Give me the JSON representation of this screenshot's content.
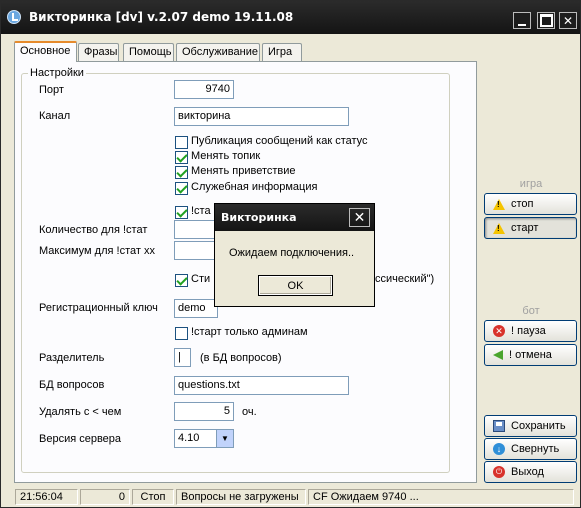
{
  "window": {
    "title": "Викторинка [dv] v.2.07 demo 19.11.08"
  },
  "tabs": [
    {
      "label": "Основное",
      "active": true
    },
    {
      "label": "Фразы"
    },
    {
      "label": "Помощь"
    },
    {
      "label": "Обслуживание"
    },
    {
      "label": "Игра"
    }
  ],
  "settings": {
    "group_title": "Настройки",
    "port_label": "Порт",
    "port_value": "9740",
    "channel_label": "Канал",
    "channel_value": "викторина",
    "checks": {
      "publish_status": {
        "label": "Публикация сообщений как статус",
        "checked": false
      },
      "change_topic": {
        "label": "Менять топик",
        "checked": true
      },
      "change_greeting": {
        "label": "Менять приветствие",
        "checked": true
      },
      "service_info": {
        "label": "Служебная информация",
        "checked": true
      },
      "stat_partial": {
        "label": "!ста",
        "checked": true
      },
      "style_partial": {
        "label": "Сти",
        "checked": true
      },
      "start_admins": {
        "label": "!старт только админам",
        "checked": false
      }
    },
    "style_suffix": "ссический\")",
    "count_stat_label": "Количество для !стат",
    "max_stat_label": "Максимум для  !стат xx",
    "reg_key_label": "Регистрационный ключ",
    "reg_key_value": "demo",
    "separator_label": "Разделитель",
    "separator_value": "|",
    "separator_hint": "(в БД вопросов)",
    "db_label": "БД вопросов",
    "db_value": "questions.txt",
    "remove_label": "Удалять  с < чем",
    "remove_value": "5",
    "remove_unit": "оч.",
    "server_version_label": "Версия сервера",
    "server_version_value": "4.10"
  },
  "side": {
    "game_caption": "игра",
    "stop_label": "стоп",
    "start_label": "старт",
    "bot_caption": "бот",
    "pause_label": "! пауза",
    "cancel_label": "! отмена",
    "save_label": "Сохранить",
    "minimize_label": "Свернуть",
    "exit_label": "Выход"
  },
  "status": {
    "time": "21:56:04",
    "count": "0",
    "state": "Стоп",
    "questions": "Вопросы не загружены",
    "connection": "CF Ожидаем 9740 ..."
  },
  "dialog": {
    "title": "Викторинка",
    "message": "Ожидаем подключения..",
    "ok_label": "OK"
  }
}
